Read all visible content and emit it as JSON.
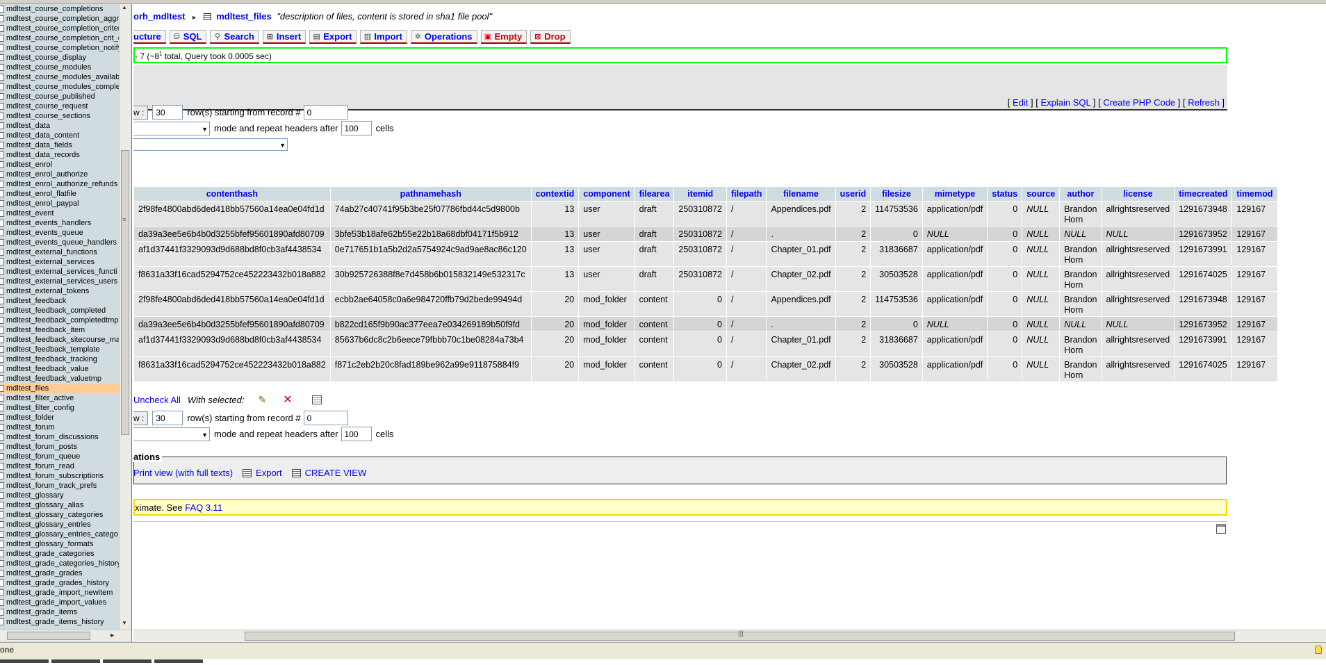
{
  "sidebar": {
    "tables": [
      "mdltest_course_completions",
      "mdltest_course_completion_aggr_",
      "mdltest_course_completion_criter",
      "mdltest_course_completion_crit_c",
      "mdltest_course_completion_notify",
      "mdltest_course_display",
      "mdltest_course_modules",
      "mdltest_course_modules_availab",
      "mdltest_course_modules_comple",
      "mdltest_course_published",
      "mdltest_course_request",
      "mdltest_course_sections",
      "mdltest_data",
      "mdltest_data_content",
      "mdltest_data_fields",
      "mdltest_data_records",
      "mdltest_enrol",
      "mdltest_enrol_authorize",
      "mdltest_enrol_authorize_refunds",
      "mdltest_enrol_flatfile",
      "mdltest_enrol_paypal",
      "mdltest_event",
      "mdltest_events_handlers",
      "mdltest_events_queue",
      "mdltest_events_queue_handlers",
      "mdltest_external_functions",
      "mdltest_external_services",
      "mdltest_external_services_functi",
      "mdltest_external_services_users",
      "mdltest_external_tokens",
      "mdltest_feedback",
      "mdltest_feedback_completed",
      "mdltest_feedback_completedtmp",
      "mdltest_feedback_item",
      "mdltest_feedback_sitecourse_ma",
      "mdltest_feedback_template",
      "mdltest_feedback_tracking",
      "mdltest_feedback_value",
      "mdltest_feedback_valuetmp",
      "mdltest_files",
      "mdltest_filter_active",
      "mdltest_filter_config",
      "mdltest_folder",
      "mdltest_forum",
      "mdltest_forum_discussions",
      "mdltest_forum_posts",
      "mdltest_forum_queue",
      "mdltest_forum_read",
      "mdltest_forum_subscriptions",
      "mdltest_forum_track_prefs",
      "mdltest_glossary",
      "mdltest_glossary_alias",
      "mdltest_glossary_categories",
      "mdltest_glossary_entries",
      "mdltest_glossary_entries_catego",
      "mdltest_glossary_formats",
      "mdltest_grade_categories",
      "mdltest_grade_categories_history",
      "mdltest_grade_grades",
      "mdltest_grade_grades_history",
      "mdltest_grade_import_newitem",
      "mdltest_grade_import_values",
      "mdltest_grade_items",
      "mdltest_grade_items_history"
    ],
    "active_table": "mdltest_files"
  },
  "breadcrumb": {
    "database": "orh_mdltest",
    "table": "mdltest_files",
    "comment": "\"description of files, content is stored in sha1 file pool\""
  },
  "tabs": [
    {
      "label": "ucture",
      "icon": "structure-icon",
      "danger": false
    },
    {
      "label": "SQL",
      "icon": "sql-icon",
      "danger": false
    },
    {
      "label": "Search",
      "icon": "search-icon",
      "danger": false
    },
    {
      "label": "Insert",
      "icon": "insert-icon",
      "danger": false
    },
    {
      "label": "Export",
      "icon": "export-icon",
      "danger": false
    },
    {
      "label": "Import",
      "icon": "import-icon",
      "danger": false
    },
    {
      "label": "Operations",
      "icon": "wrench-icon",
      "danger": false
    },
    {
      "label": "Empty",
      "icon": "empty-icon",
      "danger": true
    },
    {
      "label": "Drop",
      "icon": "drop-icon",
      "danger": true
    }
  ],
  "result": {
    "message_prefix": "- 7 (~8",
    "message_sup": "1",
    "message_suffix": " total, Query took 0.0005 sec)"
  },
  "sql_actions": {
    "edit": "Edit",
    "explain": "Explain SQL",
    "php": "Create PHP Code",
    "refresh": "Refresh"
  },
  "nav": {
    "show_label": "w :",
    "rows_value": "30",
    "rows_text": "row(s) starting from record #",
    "start_value": "0",
    "mode_text": "mode and repeat headers after",
    "headers_value": "100",
    "cells_text": "cells"
  },
  "table": {
    "columns": [
      "contenthash",
      "pathnamehash",
      "contextid",
      "component",
      "filearea",
      "itemid",
      "filepath",
      "filename",
      "userid",
      "filesize",
      "mimetype",
      "status",
      "source",
      "author",
      "license",
      "timecreated",
      "timemod"
    ],
    "rows": [
      [
        "2f98fe4800abd6ded418bb57560a14ea0e04fd1d",
        "74ab27c40741f95b3be25f07786fbd44c5d9800b",
        "13",
        "user",
        "draft",
        "250310872",
        "/",
        "Appendices.pdf",
        "2",
        "114753536",
        "application/pdf",
        "0",
        "NULL",
        "Brandon Horn",
        "allrightsreserved",
        "1291673948",
        "129167"
      ],
      [
        "da39a3ee5e6b4b0d3255bfef95601890afd80709",
        "3bfe53b18afe62b55e22b18a68dbf04171f5b912",
        "13",
        "user",
        "draft",
        "250310872",
        "/",
        ".",
        "2",
        "0",
        "NULL",
        "0",
        "NULL",
        "NULL",
        "NULL",
        "1291673952",
        "129167"
      ],
      [
        "af1d37441f3329093d9d688bd8f0cb3af4438534",
        "0e717651b1a5b2d2a5754924c9ad9ae8ac86c120",
        "13",
        "user",
        "draft",
        "250310872",
        "/",
        "Chapter_01.pdf",
        "2",
        "31836687",
        "application/pdf",
        "0",
        "NULL",
        "Brandon Horn",
        "allrightsreserved",
        "1291673991",
        "129167"
      ],
      [
        "f8631a33f16cad5294752ce452223432b018a882",
        "30b925726388f8e7d458b6b015832149e532317c",
        "13",
        "user",
        "draft",
        "250310872",
        "/",
        "Chapter_02.pdf",
        "2",
        "30503528",
        "application/pdf",
        "0",
        "NULL",
        "Brandon Horn",
        "allrightsreserved",
        "1291674025",
        "129167"
      ],
      [
        "2f98fe4800abd6ded418bb57560a14ea0e04fd1d",
        "ecbb2ae64058c0a6e984720ffb79d2bede99494d",
        "20",
        "mod_folder",
        "content",
        "0",
        "/",
        "Appendices.pdf",
        "2",
        "114753536",
        "application/pdf",
        "0",
        "NULL",
        "Brandon Horn",
        "allrightsreserved",
        "1291673948",
        "129167"
      ],
      [
        "da39a3ee5e6b4b0d3255bfef95601890afd80709",
        "b822cd165f9b90ac377eea7e034269189b50f9fd",
        "20",
        "mod_folder",
        "content",
        "0",
        "/",
        ".",
        "2",
        "0",
        "NULL",
        "0",
        "NULL",
        "NULL",
        "NULL",
        "1291673952",
        "129167"
      ],
      [
        "af1d37441f3329093d9d688bd8f0cb3af4438534",
        "85637b6dc8c2b6eece79fbbb70c1be08284a73b4",
        "20",
        "mod_folder",
        "content",
        "0",
        "/",
        "Chapter_01.pdf",
        "2",
        "31836687",
        "application/pdf",
        "0",
        "NULL",
        "Brandon Horn",
        "allrightsreserved",
        "1291673991",
        "129167"
      ],
      [
        "f8631a33f16cad5294752ce452223432b018a882",
        "f871c2eb2b20c8fad189be962a99e911875884f9",
        "20",
        "mod_folder",
        "content",
        "0",
        "/",
        "Chapter_02.pdf",
        "2",
        "30503528",
        "application/pdf",
        "0",
        "NULL",
        "Brandon Horn",
        "allrightsreserved",
        "1291674025",
        "129167"
      ]
    ]
  },
  "bulk": {
    "uncheck_all": "Uncheck All",
    "with_selected": "With selected:"
  },
  "operations": {
    "legend": "ations",
    "print_view": "Print view (with full texts)",
    "export": "Export",
    "create_view": "CREATE VIEW"
  },
  "notice": {
    "text": "ximate. See ",
    "link": "FAQ 3.11"
  },
  "statusbar": {
    "text": "one"
  }
}
